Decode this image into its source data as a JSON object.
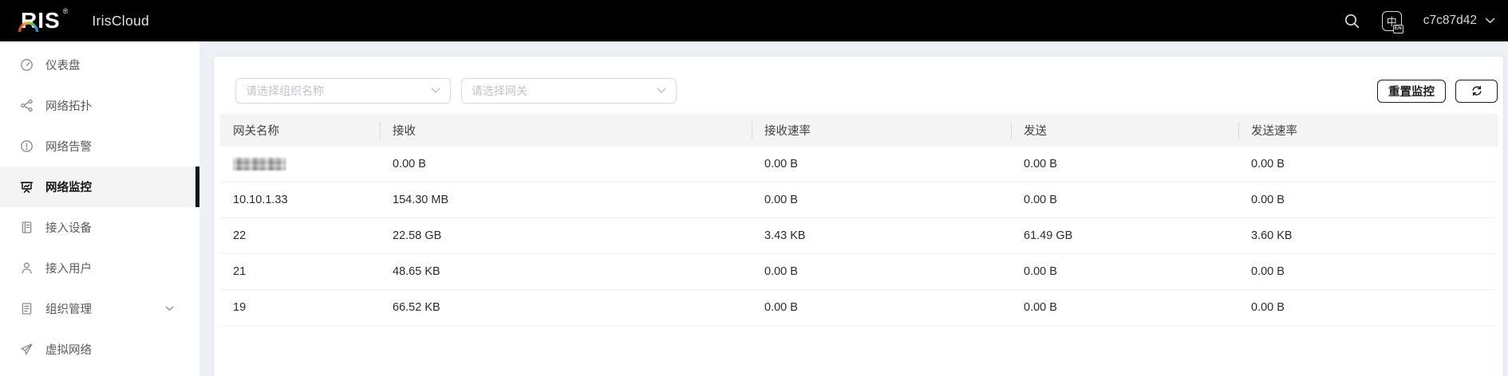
{
  "topbar": {
    "brand_text": "RIS",
    "brand_reg": "®",
    "product_name": "IrisCloud",
    "username": "c7c87d42"
  },
  "sidebar": {
    "items": [
      {
        "label": "仪表盘",
        "icon": "gauge-icon",
        "selected": false
      },
      {
        "label": "网络拓扑",
        "icon": "topology-icon",
        "selected": false
      },
      {
        "label": "网络告警",
        "icon": "alert-icon",
        "selected": false
      },
      {
        "label": "网络监控",
        "icon": "monitor-icon",
        "selected": true
      },
      {
        "label": "接入设备",
        "icon": "device-icon",
        "selected": false
      },
      {
        "label": "接入用户",
        "icon": "user-icon",
        "selected": false
      },
      {
        "label": "组织管理",
        "icon": "org-icon",
        "selected": false,
        "expandable": true
      },
      {
        "label": "虚拟网络",
        "icon": "paper-plane-icon",
        "selected": false
      }
    ]
  },
  "filters": {
    "org_select_placeholder": "请选择组织名称",
    "gateway_select_placeholder": "请选择网关"
  },
  "toolbar": {
    "reset_button_label": "重置监控"
  },
  "table": {
    "columns": [
      "网关名称",
      "接收",
      "接收速率",
      "发送",
      "发送速率"
    ],
    "rows": [
      {
        "redacted": true,
        "cells": [
          "",
          "0.00 B",
          "0.00 B",
          "0.00 B",
          "0.00 B"
        ]
      },
      {
        "redacted": false,
        "cells": [
          "10.10.1.33",
          "154.30 MB",
          "0.00 B",
          "0.00 B",
          "0.00 B"
        ]
      },
      {
        "redacted": false,
        "cells": [
          "22",
          "22.58 GB",
          "3.43 KB",
          "61.49 GB",
          "3.60 KB"
        ]
      },
      {
        "redacted": false,
        "cells": [
          "21",
          "48.65 KB",
          "0.00 B",
          "0.00 B",
          "0.00 B"
        ]
      },
      {
        "redacted": false,
        "cells": [
          "19",
          "66.52 KB",
          "0.00 B",
          "0.00 B",
          "0.00 B"
        ]
      }
    ]
  },
  "colors": {
    "topbar_bg": "#000000",
    "accent_dark": "#141414",
    "selected_item_bg": "#f4f4f4",
    "main_bg": "#edf0f5",
    "table_header_bg": "#f4f4f4"
  }
}
